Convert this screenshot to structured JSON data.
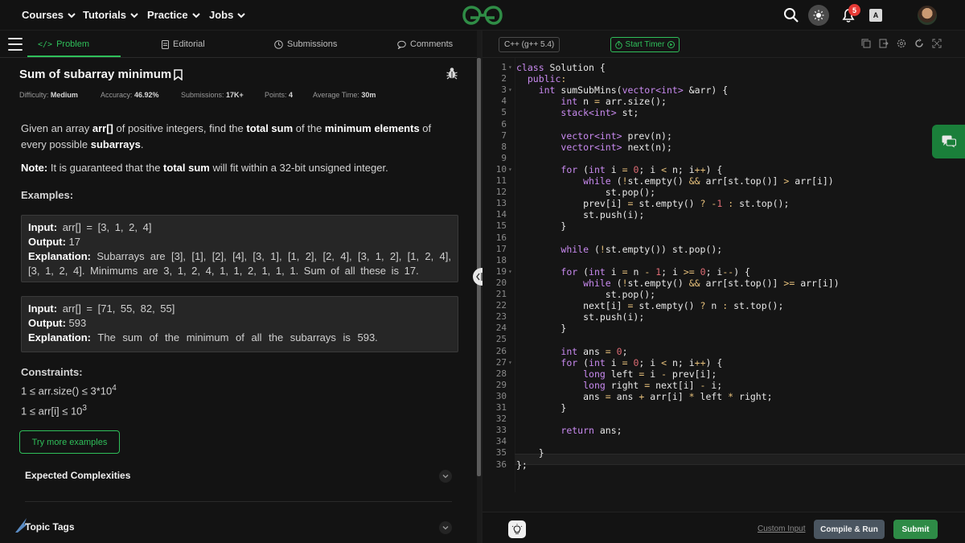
{
  "topnav": {
    "items": [
      {
        "label": "Courses"
      },
      {
        "label": "Tutorials"
      },
      {
        "label": "Practice"
      },
      {
        "label": "Jobs"
      }
    ],
    "notification_count": "5",
    "translate_glyph": "A"
  },
  "tabs": {
    "problem": "Problem",
    "editorial": "Editorial",
    "submissions": "Submissions",
    "comments": "Comments"
  },
  "problem": {
    "title": "Sum of subarray minimum",
    "difficulty_label": "Difficulty:",
    "difficulty": "Medium",
    "accuracy_label": "Accuracy:",
    "accuracy": "46.92%",
    "submissions_label": "Submissions:",
    "submissions": "17K+",
    "points_label": "Points:",
    "points": "4",
    "avg_time_label": "Average Time:",
    "avg_time": "30m",
    "statement_parts": [
      "Given an array ",
      "arr[]",
      " of positive integers, find the ",
      "total sum",
      " of the ",
      "minimum elements",
      " of every possible ",
      "subarrays",
      "."
    ],
    "note_label": "Note:",
    "note_pre": " It is guaranteed that the ",
    "note_bold": "total sum",
    "note_post": " will fit within a 32-bit unsigned integer.",
    "examples_heading": "Examples:",
    "examples": [
      {
        "input_label": "Input:",
        "input": " arr[] = [3, 1, 2, 4]",
        "output_label": "Output:",
        "output": " 17",
        "explanation_label": "Explanation:",
        "explanation": " Subarrays are [3], [1], [2], [4], [3, 1], [1, 2], [2, 4], [3, 1, 2], [1, 2, 4], [3, 1, 2, 4]. Minimums are 3, 1, 2, 4, 1, 1, 2, 1, 1, 1. Sum of all these is 17."
      },
      {
        "input_label": "Input:",
        "input": " arr[] = [71, 55, 82, 55]",
        "output_label": "Output:",
        "output": " 593",
        "explanation_label": "Explanation:",
        "explanation": " The sum of the minimum of all the subarrays is 593."
      }
    ],
    "constraints_heading": "Constraints:",
    "constraint1_base": "1 ≤ arr.size() ≤ 3*10",
    "constraint1_exp": "4",
    "constraint2_base": "1 ≤ arr[i] ≤ 10",
    "constraint2_exp": "3",
    "try_more": "Try more examples",
    "expected_complexities": "Expected Complexities",
    "topic_tags": "Topic Tags"
  },
  "editor": {
    "language": "C++ (g++ 5.4)",
    "timer": "Start Timer",
    "line_numbers": [
      "1",
      "2",
      "3",
      "4",
      "5",
      "6",
      "7",
      "8",
      "9",
      "10",
      "11",
      "12",
      "13",
      "14",
      "15",
      "16",
      "17",
      "18",
      "19",
      "20",
      "21",
      "22",
      "23",
      "24",
      "25",
      "26",
      "27",
      "28",
      "29",
      "30",
      "31",
      "32",
      "33",
      "34",
      "35",
      "36"
    ],
    "code_lines": [
      "class Solution {",
      "  public:",
      "    int sumSubMins(vector<int> &arr) {",
      "        int n = arr.size();",
      "        stack<int> st;",
      "",
      "        vector<int> prev(n);",
      "        vector<int> next(n);",
      "",
      "        for (int i = 0; i < n; i++) {",
      "            while (!st.empty() && arr[st.top()] > arr[i])",
      "                st.pop();",
      "            prev[i] = st.empty() ? -1 : st.top();",
      "            st.push(i);",
      "        }",
      "",
      "        while (!st.empty()) st.pop();",
      "",
      "        for (int i = n - 1; i >= 0; i--) {",
      "            while (!st.empty() && arr[st.top()] >= arr[i])",
      "                st.pop();",
      "            next[i] = st.empty() ? n : st.top();",
      "            st.push(i);",
      "        }",
      "",
      "        int ans = 0;",
      "        for (int i = 0; i < n; i++) {",
      "            long left = i - prev[i];",
      "            long right = next[i] - i;",
      "            ans = ans + arr[i] * left * right;",
      "        }",
      "",
      "        return ans;",
      "",
      "    }",
      "};"
    ],
    "fold_lines": [
      "1",
      "3",
      "10",
      "19",
      "27"
    ]
  },
  "bottom": {
    "custom_input": "Custom Input",
    "compile_run": "Compile & Run",
    "submit": "Submit"
  },
  "colors": {
    "accent": "#2fbf5a",
    "submit": "#2e8b46",
    "compile": "#4a5560",
    "badge": "#e53935"
  }
}
